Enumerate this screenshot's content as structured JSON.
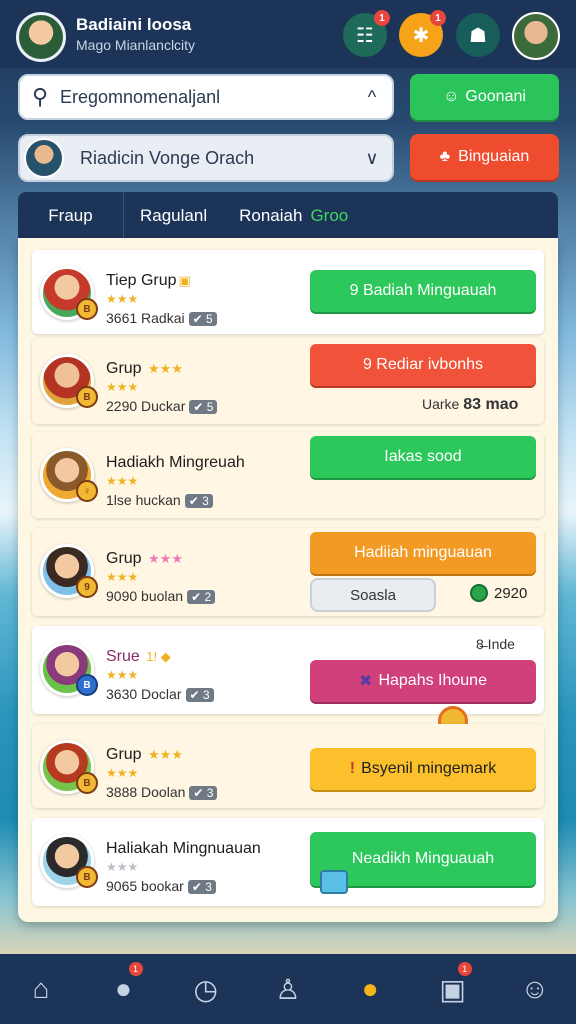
{
  "header": {
    "profile_name": "Badiaini loosa",
    "profile_sub": "Mago Mianlanclcity",
    "btn1_icon": "chat-icon",
    "btn1_glyph": "☷",
    "btn1_badge": "1",
    "btn2_icon": "gift-icon",
    "btn2_glyph": "✱",
    "btn2_badge": "1",
    "btn3_icon": "friends-icon",
    "btn3_glyph": "☗"
  },
  "search": {
    "value": "Eregomnomenaljanl",
    "search_glyph": "⚲",
    "chevron": "^"
  },
  "go_button": {
    "label": "Goonani",
    "glyph": "☺"
  },
  "group_selector": {
    "value": "Riadicin Vonge Orach",
    "chevron": "∨"
  },
  "invite_button": {
    "label": "Binguaian",
    "glyph": "♣"
  },
  "tabs": [
    "Fraup",
    "Ragulanl",
    "Ronaiah",
    "Groo"
  ],
  "list": [
    {
      "name": "Tiep Grup",
      "deco": "▣",
      "stars": "★★★",
      "meta": "3661 Radkai",
      "level": "✔ 5",
      "action": "9 Badiah Minguauah",
      "action_color": "green",
      "avatar_color": "#4aa85a",
      "badge_glyph": "B"
    },
    {
      "name": "Grup",
      "deco": "★★★",
      "stars": "★★★",
      "meta": "2290 Duckar",
      "level": "✔ 5",
      "action": "9 Rediar ivbonhs",
      "action_color": "red",
      "avatar_color": "#c84a2a",
      "badge_glyph": "B",
      "side_label": "Uarke",
      "side_value": "83 mao"
    },
    {
      "name": "Hadiakh Mingreuah",
      "stars": "★★★",
      "meta": "1lse huckan",
      "level": "✔ 3",
      "action": "Iakas sood",
      "action_color": "green",
      "avatar_color": "#e9a53a",
      "badge_glyph": "♀"
    },
    {
      "name": "Grup",
      "deco": "★★★",
      "stars": "★★★",
      "meta": "9090 buolan",
      "level": "✔ 2",
      "action": "Hadiiah minguauan",
      "action_color": "orange",
      "avatar_color": "#5aa3d8",
      "badge_glyph": "9",
      "sub_button": "Soasla",
      "count_value": "2920"
    },
    {
      "name": "Srue",
      "deco": "1! ◆",
      "stars": "★★★",
      "meta": "3630 Doclar",
      "level": "✔ 3",
      "action": "Hapahs Ihoune",
      "action_glyph": "✖",
      "action_color": "magenta",
      "avatar_color": "#6ac24a",
      "badge_glyph": "B",
      "side_label": "8̶ Inde"
    },
    {
      "name": "Grup",
      "deco": "★★★",
      "stars": "★★★",
      "meta": "3888 Doolan",
      "level": "✔ 3",
      "action": "Bsyenil mingemark",
      "action_glyph": "!",
      "action_color": "yellow",
      "avatar_color": "#77c248",
      "badge_glyph": "B"
    },
    {
      "name": "Haliakah Mingnuauan",
      "stars": "★★★",
      "meta": "9065 bookar",
      "level": "✔ 3",
      "action": "Neadikh Minguauah",
      "action_color": "green",
      "avatar_color": "#5fb8d8",
      "badge_glyph": "B"
    }
  ],
  "bottom_nav": [
    {
      "icon": "home-icon",
      "glyph": "⌂"
    },
    {
      "icon": "profile-icon",
      "glyph": "●",
      "badge": "1"
    },
    {
      "icon": "clock-icon",
      "glyph": "◷"
    },
    {
      "icon": "user-outline-icon",
      "glyph": "♙"
    },
    {
      "icon": "group-icon",
      "glyph": "●",
      "active": true
    },
    {
      "icon": "gift-icon",
      "glyph": "▣",
      "badge": "1"
    },
    {
      "icon": "person-icon",
      "glyph": "☺"
    }
  ]
}
